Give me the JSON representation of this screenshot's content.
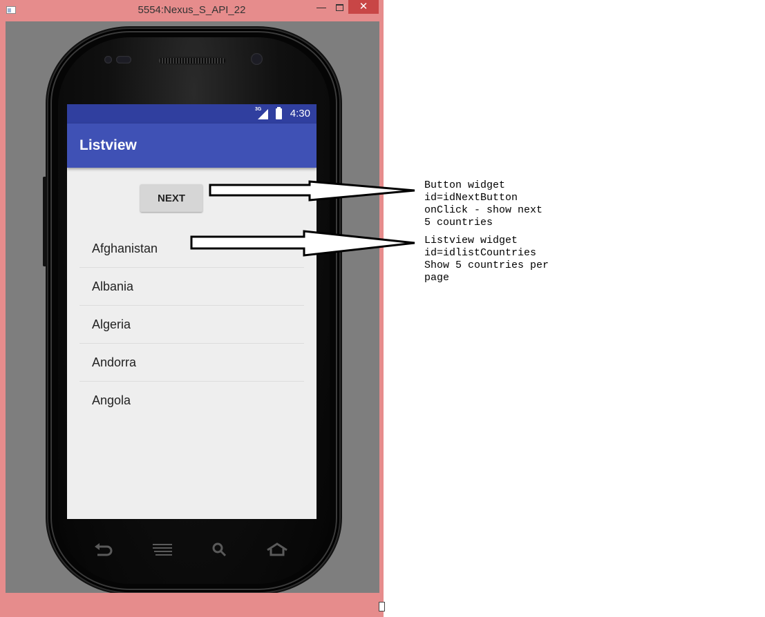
{
  "window": {
    "title": "5554:Nexus_S_API_22",
    "minimize_glyph": "—",
    "close_glyph": "✕"
  },
  "status_bar": {
    "time": "4:30",
    "network": "3G"
  },
  "app_bar": {
    "title": "Listview"
  },
  "next_button": {
    "label": "NEXT"
  },
  "countries": [
    "Afghanistan",
    "Albania",
    "Algeria",
    "Andorra",
    "Angola"
  ],
  "nav_bar": {
    "icons": [
      "back-icon",
      "menu-icon",
      "search-icon",
      "home-icon"
    ]
  },
  "annotations": {
    "button_note": "Button widget\nid=idNextButton\nonClick - show next\n5 countries",
    "list_note": "Listview widget\nid=idlistCountries\nShow 5 countries per\npage"
  },
  "colors": {
    "window_frame": "#e68c8c",
    "close_button": "#c84646",
    "status_bar": "#303f9f",
    "app_bar": "#3f51b5",
    "screen_bg": "#eeeeee"
  }
}
